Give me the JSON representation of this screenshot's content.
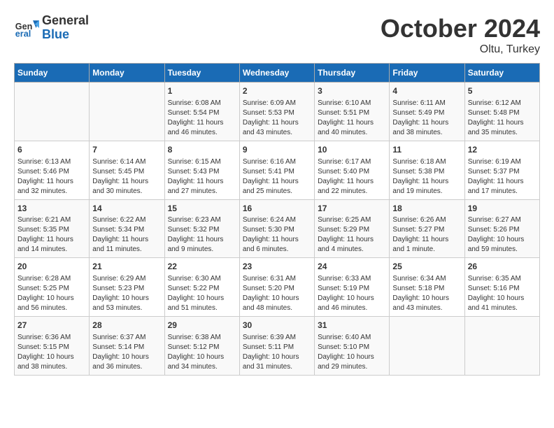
{
  "header": {
    "logo_general": "General",
    "logo_blue": "Blue",
    "month_title": "October 2024",
    "location": "Oltu, Turkey"
  },
  "days_of_week": [
    "Sunday",
    "Monday",
    "Tuesday",
    "Wednesday",
    "Thursday",
    "Friday",
    "Saturday"
  ],
  "weeks": [
    [
      {
        "day": "",
        "sunrise": "",
        "sunset": "",
        "daylight": ""
      },
      {
        "day": "",
        "sunrise": "",
        "sunset": "",
        "daylight": ""
      },
      {
        "day": "1",
        "sunrise": "Sunrise: 6:08 AM",
        "sunset": "Sunset: 5:54 PM",
        "daylight": "Daylight: 11 hours and 46 minutes."
      },
      {
        "day": "2",
        "sunrise": "Sunrise: 6:09 AM",
        "sunset": "Sunset: 5:53 PM",
        "daylight": "Daylight: 11 hours and 43 minutes."
      },
      {
        "day": "3",
        "sunrise": "Sunrise: 6:10 AM",
        "sunset": "Sunset: 5:51 PM",
        "daylight": "Daylight: 11 hours and 40 minutes."
      },
      {
        "day": "4",
        "sunrise": "Sunrise: 6:11 AM",
        "sunset": "Sunset: 5:49 PM",
        "daylight": "Daylight: 11 hours and 38 minutes."
      },
      {
        "day": "5",
        "sunrise": "Sunrise: 6:12 AM",
        "sunset": "Sunset: 5:48 PM",
        "daylight": "Daylight: 11 hours and 35 minutes."
      }
    ],
    [
      {
        "day": "6",
        "sunrise": "Sunrise: 6:13 AM",
        "sunset": "Sunset: 5:46 PM",
        "daylight": "Daylight: 11 hours and 32 minutes."
      },
      {
        "day": "7",
        "sunrise": "Sunrise: 6:14 AM",
        "sunset": "Sunset: 5:45 PM",
        "daylight": "Daylight: 11 hours and 30 minutes."
      },
      {
        "day": "8",
        "sunrise": "Sunrise: 6:15 AM",
        "sunset": "Sunset: 5:43 PM",
        "daylight": "Daylight: 11 hours and 27 minutes."
      },
      {
        "day": "9",
        "sunrise": "Sunrise: 6:16 AM",
        "sunset": "Sunset: 5:41 PM",
        "daylight": "Daylight: 11 hours and 25 minutes."
      },
      {
        "day": "10",
        "sunrise": "Sunrise: 6:17 AM",
        "sunset": "Sunset: 5:40 PM",
        "daylight": "Daylight: 11 hours and 22 minutes."
      },
      {
        "day": "11",
        "sunrise": "Sunrise: 6:18 AM",
        "sunset": "Sunset: 5:38 PM",
        "daylight": "Daylight: 11 hours and 19 minutes."
      },
      {
        "day": "12",
        "sunrise": "Sunrise: 6:19 AM",
        "sunset": "Sunset: 5:37 PM",
        "daylight": "Daylight: 11 hours and 17 minutes."
      }
    ],
    [
      {
        "day": "13",
        "sunrise": "Sunrise: 6:21 AM",
        "sunset": "Sunset: 5:35 PM",
        "daylight": "Daylight: 11 hours and 14 minutes."
      },
      {
        "day": "14",
        "sunrise": "Sunrise: 6:22 AM",
        "sunset": "Sunset: 5:34 PM",
        "daylight": "Daylight: 11 hours and 11 minutes."
      },
      {
        "day": "15",
        "sunrise": "Sunrise: 6:23 AM",
        "sunset": "Sunset: 5:32 PM",
        "daylight": "Daylight: 11 hours and 9 minutes."
      },
      {
        "day": "16",
        "sunrise": "Sunrise: 6:24 AM",
        "sunset": "Sunset: 5:30 PM",
        "daylight": "Daylight: 11 hours and 6 minutes."
      },
      {
        "day": "17",
        "sunrise": "Sunrise: 6:25 AM",
        "sunset": "Sunset: 5:29 PM",
        "daylight": "Daylight: 11 hours and 4 minutes."
      },
      {
        "day": "18",
        "sunrise": "Sunrise: 6:26 AM",
        "sunset": "Sunset: 5:27 PM",
        "daylight": "Daylight: 11 hours and 1 minute."
      },
      {
        "day": "19",
        "sunrise": "Sunrise: 6:27 AM",
        "sunset": "Sunset: 5:26 PM",
        "daylight": "Daylight: 10 hours and 59 minutes."
      }
    ],
    [
      {
        "day": "20",
        "sunrise": "Sunrise: 6:28 AM",
        "sunset": "Sunset: 5:25 PM",
        "daylight": "Daylight: 10 hours and 56 minutes."
      },
      {
        "day": "21",
        "sunrise": "Sunrise: 6:29 AM",
        "sunset": "Sunset: 5:23 PM",
        "daylight": "Daylight: 10 hours and 53 minutes."
      },
      {
        "day": "22",
        "sunrise": "Sunrise: 6:30 AM",
        "sunset": "Sunset: 5:22 PM",
        "daylight": "Daylight: 10 hours and 51 minutes."
      },
      {
        "day": "23",
        "sunrise": "Sunrise: 6:31 AM",
        "sunset": "Sunset: 5:20 PM",
        "daylight": "Daylight: 10 hours and 48 minutes."
      },
      {
        "day": "24",
        "sunrise": "Sunrise: 6:33 AM",
        "sunset": "Sunset: 5:19 PM",
        "daylight": "Daylight: 10 hours and 46 minutes."
      },
      {
        "day": "25",
        "sunrise": "Sunrise: 6:34 AM",
        "sunset": "Sunset: 5:18 PM",
        "daylight": "Daylight: 10 hours and 43 minutes."
      },
      {
        "day": "26",
        "sunrise": "Sunrise: 6:35 AM",
        "sunset": "Sunset: 5:16 PM",
        "daylight": "Daylight: 10 hours and 41 minutes."
      }
    ],
    [
      {
        "day": "27",
        "sunrise": "Sunrise: 6:36 AM",
        "sunset": "Sunset: 5:15 PM",
        "daylight": "Daylight: 10 hours and 38 minutes."
      },
      {
        "day": "28",
        "sunrise": "Sunrise: 6:37 AM",
        "sunset": "Sunset: 5:14 PM",
        "daylight": "Daylight: 10 hours and 36 minutes."
      },
      {
        "day": "29",
        "sunrise": "Sunrise: 6:38 AM",
        "sunset": "Sunset: 5:12 PM",
        "daylight": "Daylight: 10 hours and 34 minutes."
      },
      {
        "day": "30",
        "sunrise": "Sunrise: 6:39 AM",
        "sunset": "Sunset: 5:11 PM",
        "daylight": "Daylight: 10 hours and 31 minutes."
      },
      {
        "day": "31",
        "sunrise": "Sunrise: 6:40 AM",
        "sunset": "Sunset: 5:10 PM",
        "daylight": "Daylight: 10 hours and 29 minutes."
      },
      {
        "day": "",
        "sunrise": "",
        "sunset": "",
        "daylight": ""
      },
      {
        "day": "",
        "sunrise": "",
        "sunset": "",
        "daylight": ""
      }
    ]
  ]
}
